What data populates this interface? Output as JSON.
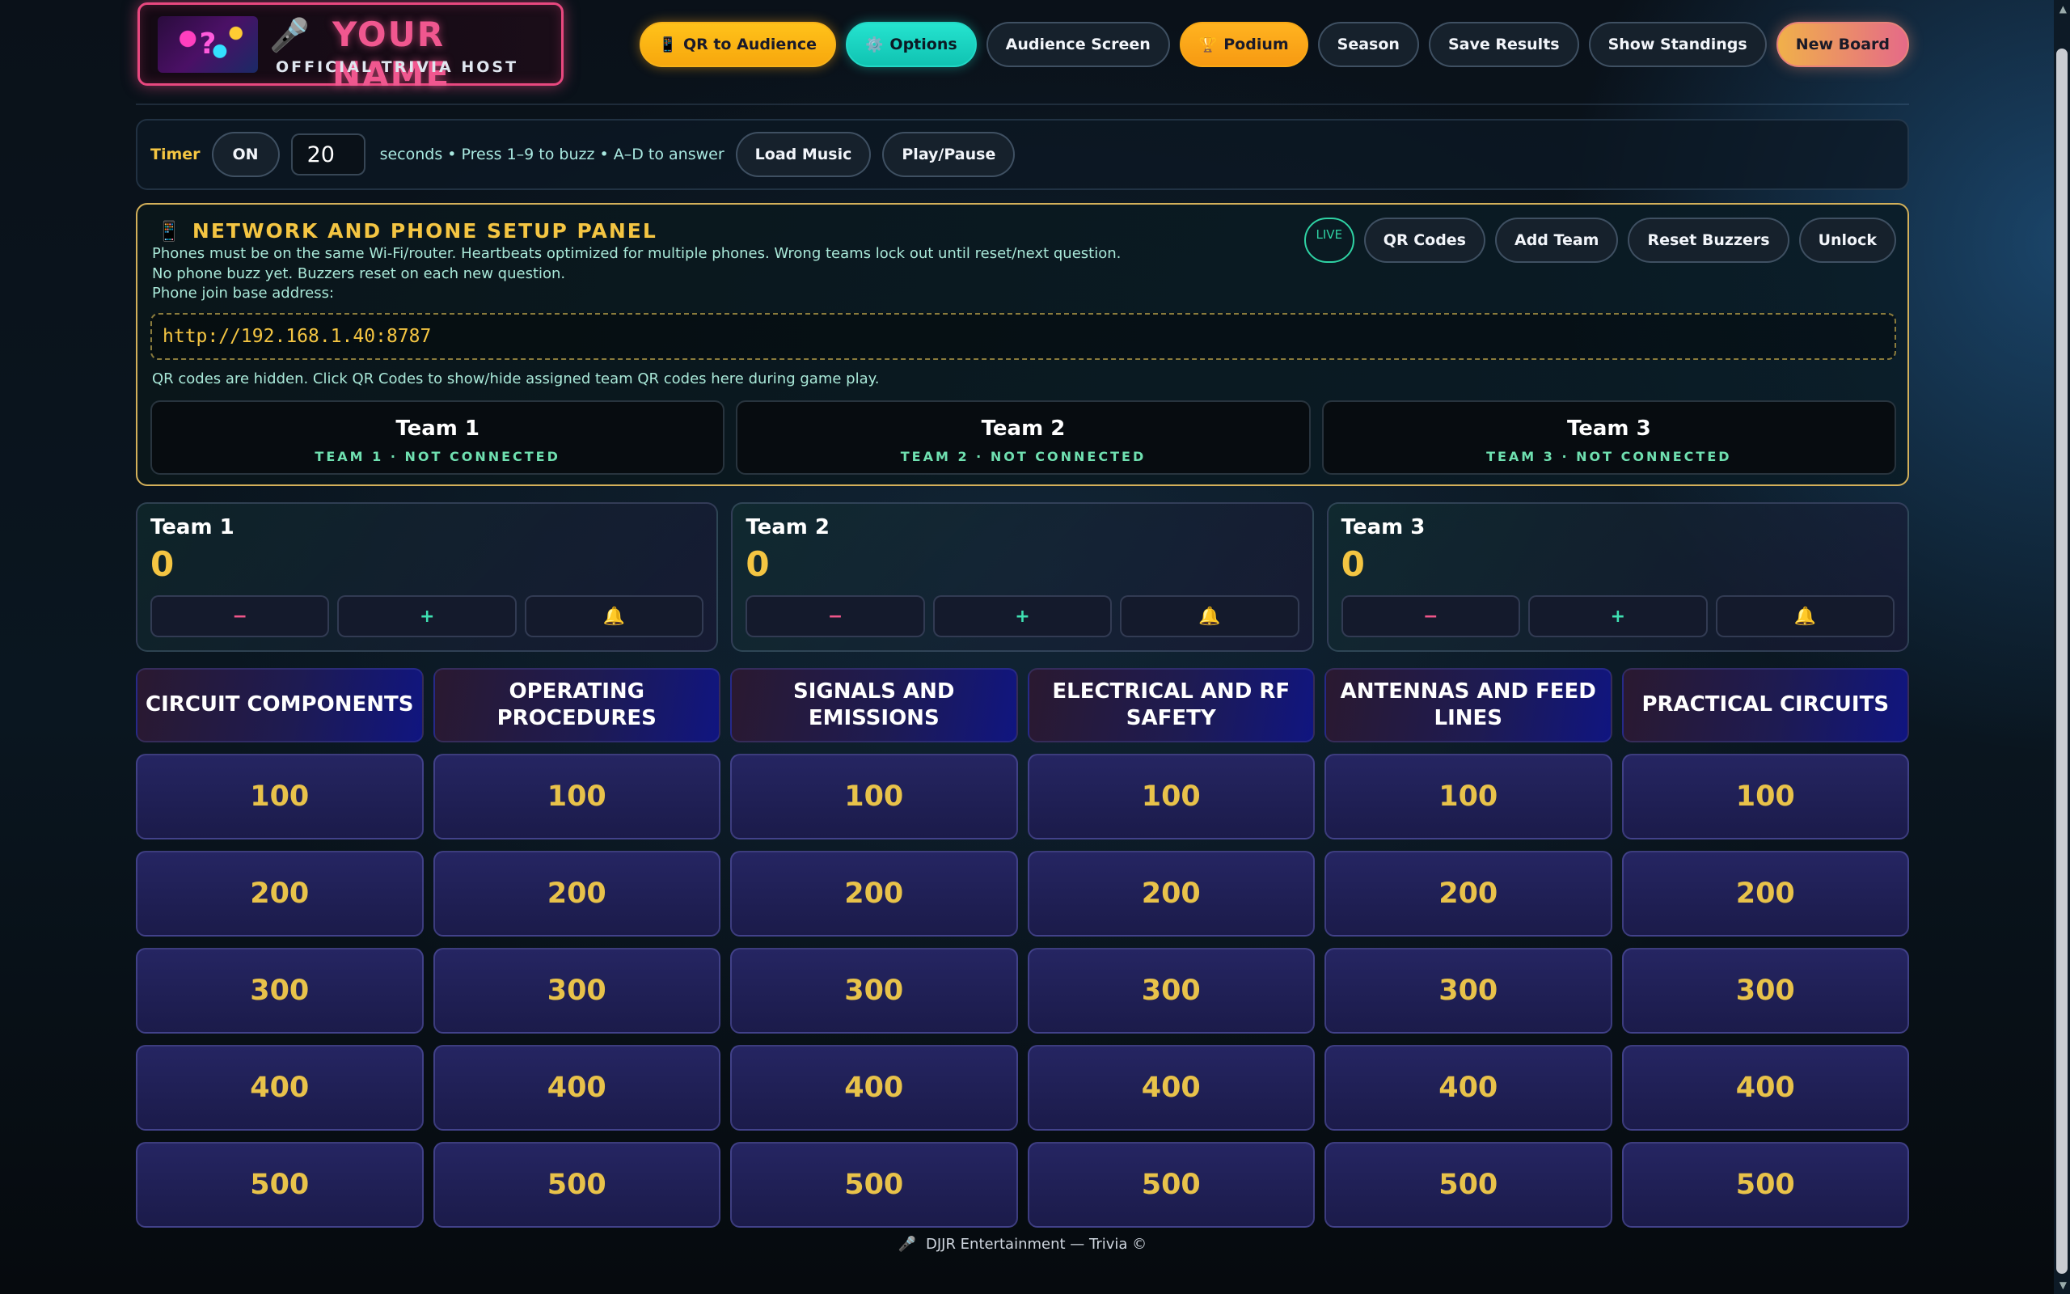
{
  "brand": {
    "name": "YOUR NAME",
    "subtitle": "OFFICIAL TRIVIA HOST"
  },
  "nav": [
    {
      "label": "QR to Audience",
      "icon": "📱",
      "icon_name": "phone-icon",
      "style": "gold"
    },
    {
      "label": "Options",
      "icon": "⚙️",
      "icon_name": "gear-icon",
      "style": "teal"
    },
    {
      "label": "Audience Screen",
      "icon": "",
      "style": "dark"
    },
    {
      "label": "Podium",
      "icon": "🏆",
      "icon_name": "trophy-icon",
      "style": "orange"
    },
    {
      "label": "Season",
      "icon": "",
      "style": "dark"
    },
    {
      "label": "Save Results",
      "icon": "",
      "style": "dark"
    },
    {
      "label": "Show Standings",
      "icon": "",
      "style": "dark"
    },
    {
      "label": "New Board",
      "icon": "",
      "style": "newboard"
    }
  ],
  "timer": {
    "label": "Timer",
    "toggle": "ON",
    "seconds": "20",
    "hint": "seconds • Press 1–9 to buzz • A–D to answer",
    "load_music": "Load Music",
    "play_pause": "Play/Pause"
  },
  "network": {
    "icon": "📱",
    "title": "NETWORK AND PHONE SETUP PANEL",
    "line1": "Phones must be on the same Wi-Fi/router. Heartbeats optimized for multiple phones. Wrong teams lock out until reset/next question.",
    "line2": "No phone buzz yet. Buzzers reset on each new question.",
    "line3": "Phone join base address:",
    "url": "http://192.168.1.40:8787",
    "qr_note": "QR codes are hidden. Click QR Codes to show/hide assigned team QR codes here during game play.",
    "live": "LIVE",
    "actions": [
      "QR Codes",
      "Add Team",
      "Reset Buzzers",
      "Unlock"
    ],
    "teams": [
      {
        "name": "Team 1",
        "status": "TEAM 1 · NOT CONNECTED"
      },
      {
        "name": "Team 2",
        "status": "TEAM 2 · NOT CONNECTED"
      },
      {
        "name": "Team 3",
        "status": "TEAM 3 · NOT CONNECTED"
      }
    ]
  },
  "scores": [
    {
      "name": "Team 1",
      "score": "0",
      "minus": "−",
      "plus": "+",
      "bell": "🔔"
    },
    {
      "name": "Team 2",
      "score": "0",
      "minus": "−",
      "plus": "+",
      "bell": "🔔"
    },
    {
      "name": "Team 3",
      "score": "0",
      "minus": "−",
      "plus": "+",
      "bell": "🔔"
    }
  ],
  "board": {
    "categories": [
      "CIRCUIT COMPONENTS",
      "OPERATING PROCEDURES",
      "SIGNALS AND EMISSIONS",
      "ELECTRICAL AND RF SAFETY",
      "ANTENNAS AND FEED LINES",
      "PRACTICAL CIRCUITS"
    ],
    "values": [
      "100",
      "200",
      "300",
      "400",
      "500"
    ]
  },
  "footer": {
    "icon": "🎤",
    "text": "DJJR Entertainment — Trivia ©"
  },
  "colors": {
    "accent_gold": "#f4c542",
    "accent_pink": "#e8487f",
    "accent_teal": "#25e3cf"
  }
}
